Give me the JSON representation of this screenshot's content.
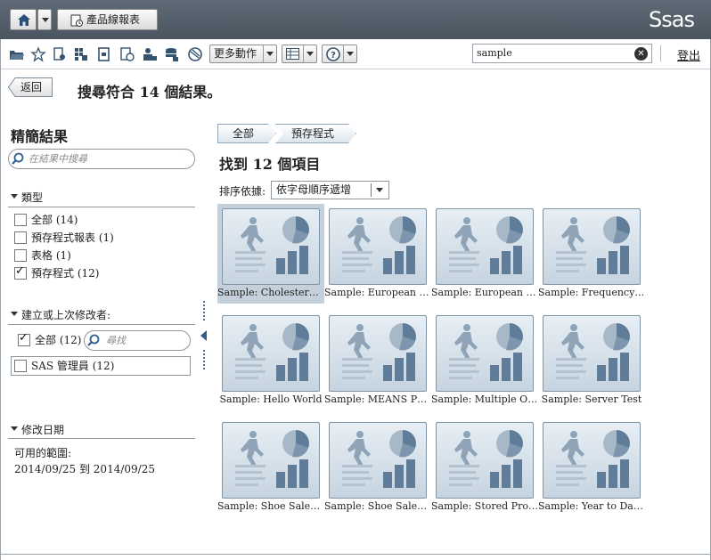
{
  "topbar": {
    "product_button_label": "產品線報表",
    "logo_text": "Ssas"
  },
  "toolbar": {
    "more_actions_label": "更多動作",
    "search_value": "sample",
    "logout_label": "登出"
  },
  "nav": {
    "back_label": "返回",
    "results_heading": "搜尋符合 14 個結果。"
  },
  "refine": {
    "title": "精簡結果",
    "search_placeholder": "在結果中搜尋",
    "type_section": {
      "title": "類型",
      "options": [
        {
          "label": "全部 (14)",
          "checked": false
        },
        {
          "label": "預存程式報表 (1)",
          "checked": false
        },
        {
          "label": "表格 (1)",
          "checked": false
        },
        {
          "label": "預存程式 (12)",
          "checked": true
        }
      ]
    },
    "modifier_section": {
      "title": "建立或上次修改者:",
      "all_label": "全部 (12)",
      "all_checked": true,
      "find_placeholder": "尋找",
      "admin_label": "SAS 管理員 (12)",
      "admin_checked": false
    },
    "date_section": {
      "title": "修改日期",
      "available_label": "可用的範圍:",
      "range": "2014/09/25 到 2014/09/25"
    }
  },
  "main": {
    "breadcrumbs": [
      "全部",
      "預存程式"
    ],
    "found_label": "找到 12 個項目",
    "sort_label": "排序依據:",
    "sort_value": "依字母順序遞增",
    "items": [
      {
        "label": "Sample: Cholesterol b...",
        "selected": true
      },
      {
        "label": "Sample: European De...",
        "selected": false
      },
      {
        "label": "Sample: European De...",
        "selected": false
      },
      {
        "label": "Sample: Frequency A...",
        "selected": false
      },
      {
        "label": "Sample: Hello World",
        "selected": false
      },
      {
        "label": "Sample: MEANS Pro...",
        "selected": false
      },
      {
        "label": "Sample: Multiple Out...",
        "selected": false
      },
      {
        "label": "Sample: Server Test",
        "selected": false
      },
      {
        "label": "Sample: Shoe Sales b...",
        "selected": false
      },
      {
        "label": "Sample: Shoe Sales G...",
        "selected": false
      },
      {
        "label": "Sample: Stored Proce...",
        "selected": false
      },
      {
        "label": "Sample: Year to Date ...",
        "selected": false
      }
    ]
  },
  "colors": {
    "topbar": "#56616b",
    "thumbnail_fill": "#d6e1ea",
    "accent_blue": "#2f5f8c"
  }
}
